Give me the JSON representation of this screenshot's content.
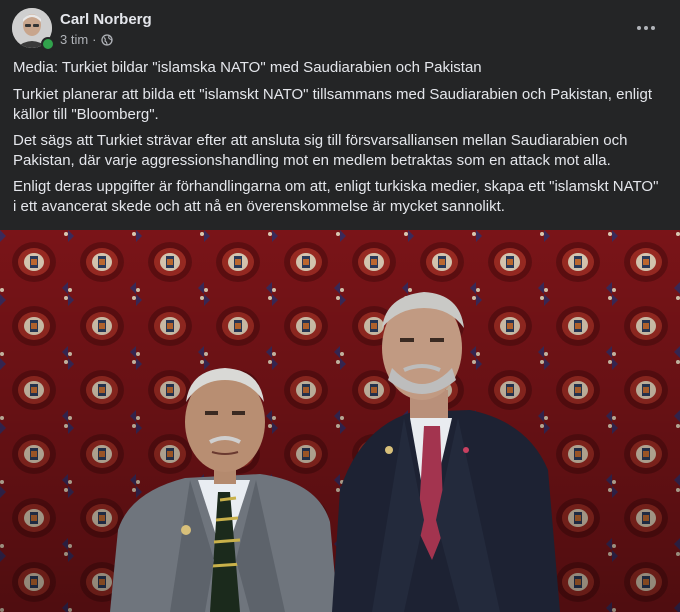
{
  "post": {
    "author": "Carl Norberg",
    "time": "3 tim",
    "separator": "·",
    "privacy_icon": "globe-icon",
    "more_icon": "more-horizontal-icon",
    "paragraphs": [
      "Media: Turkiet bildar \"islamska NATO\" med Saudiarabien och Pakistan",
      "Turkiet planerar att bilda ett \"islamskt NATO\" tillsammans med Saudiarabien och Pakistan, enligt källor till \"Bloomberg\".",
      "Det sägs att Turkiet strävar efter att ansluta sig till försvarsalliansen mellan Saudiarabien och Pakistan, där varje aggressionshandling mot en medlem betraktas som en attack mot alla.",
      "Enligt deras uppgifter är förhandlingarna om att, enligt turkiska medier, skapa ett \"islamskt NATO\" i ett avancerat skede och att nå en överenskommelse är mycket sannolikt."
    ]
  },
  "colors": {
    "background": "#242526",
    "text_primary": "#e4e6eb",
    "text_secondary": "#b0b3b8",
    "online": "#31a24c",
    "photo_backdrop": "#7a1418"
  }
}
